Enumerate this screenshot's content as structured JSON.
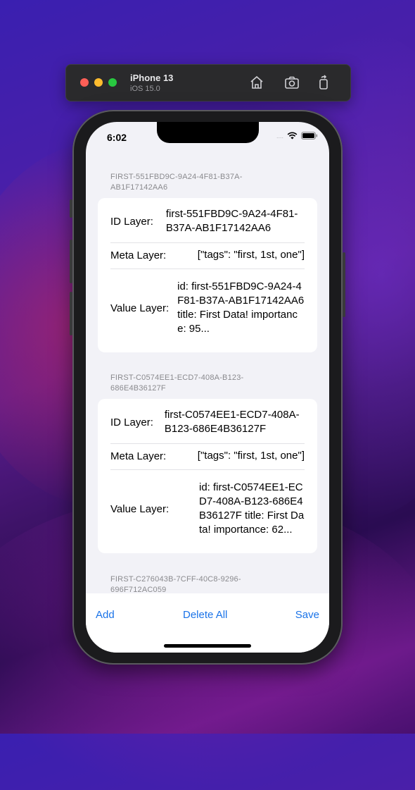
{
  "simulator": {
    "device": "iPhone 13",
    "os": "iOS 15.0",
    "buttons": [
      "home-icon",
      "screenshot-icon",
      "rotate-icon"
    ]
  },
  "status_bar": {
    "time": "6:02",
    "signal": "....",
    "icons": [
      "wifi-icon",
      "battery-icon"
    ]
  },
  "records": [
    {
      "header": "FIRST-551FBD9C-9A24-4F81-B37A-AB1F17142AA6",
      "id_label": "ID Layer:",
      "id_value": "first-551FBD9C-9A24-4F81-B37A-AB1F17142AA6",
      "meta_label": "Meta Layer:",
      "meta_value": "[\"tags\": \"first, 1st, one\"]",
      "value_label": "Value Layer:",
      "value_value": "id: first-551FBD9C-9A24-4F81-B37A-AB1F17142AA6 title: First Data! importance: 95..."
    },
    {
      "header": "FIRST-C0574EE1-ECD7-408A-B123-686E4B36127F",
      "id_label": "ID Layer:",
      "id_value": "first-C0574EE1-ECD7-408A-B123-686E4B36127F",
      "meta_label": "Meta Layer:",
      "meta_value": "[\"tags\": \"first, 1st, one\"]",
      "value_label": "Value Layer:",
      "value_value": "id: first-C0574EE1-ECD7-408A-B123-686E4B36127F title: First Data! importance: 62..."
    },
    {
      "header": "FIRST-C276043B-7CFF-40C8-9296-696F712AC059"
    }
  ],
  "toolbar": {
    "add": "Add",
    "delete_all": "Delete All",
    "save": "Save"
  },
  "colors": {
    "accent": "#1a73e8",
    "background": "#f2f2f7",
    "card": "#ffffff"
  }
}
